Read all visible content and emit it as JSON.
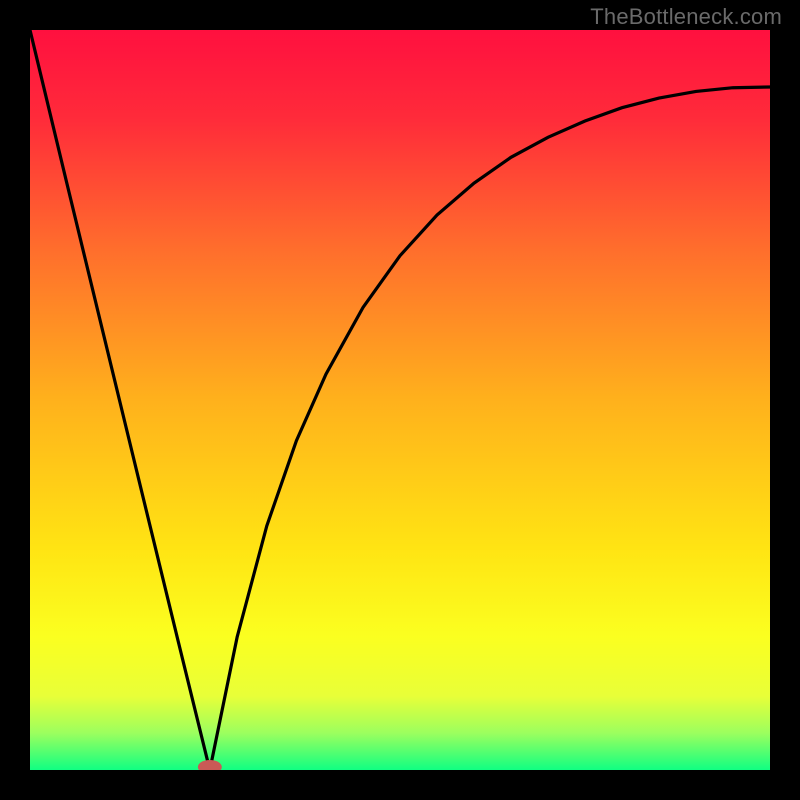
{
  "watermark": "TheBottleneck.com",
  "chart_data": {
    "type": "line",
    "x": [
      0.0,
      0.05,
      0.1,
      0.15,
      0.2,
      0.243,
      0.28,
      0.32,
      0.36,
      0.4,
      0.45,
      0.5,
      0.55,
      0.6,
      0.65,
      0.7,
      0.75,
      0.8,
      0.85,
      0.9,
      0.95,
      1.0
    ],
    "values": [
      1.0,
      0.792,
      0.586,
      0.38,
      0.175,
      0.0,
      0.18,
      0.33,
      0.445,
      0.535,
      0.625,
      0.695,
      0.75,
      0.793,
      0.828,
      0.855,
      0.877,
      0.895,
      0.908,
      0.917,
      0.922,
      0.923
    ],
    "series": [
      {
        "name": "curve",
        "values_ref": "see x/values"
      }
    ],
    "title": "",
    "xlabel": "",
    "ylabel": "",
    "xlim": [
      0,
      1
    ],
    "ylim": [
      0,
      1
    ],
    "background_gradient": {
      "stops": [
        {
          "offset": 0.0,
          "color": "#ff103f"
        },
        {
          "offset": 0.12,
          "color": "#ff2b3a"
        },
        {
          "offset": 0.3,
          "color": "#ff6f2c"
        },
        {
          "offset": 0.5,
          "color": "#ffb11c"
        },
        {
          "offset": 0.7,
          "color": "#ffe413"
        },
        {
          "offset": 0.82,
          "color": "#fbff20"
        },
        {
          "offset": 0.9,
          "color": "#e8ff38"
        },
        {
          "offset": 0.95,
          "color": "#9cff5e"
        },
        {
          "offset": 1.0,
          "color": "#10ff82"
        }
      ]
    },
    "marker": {
      "x": 0.243,
      "y": 0.0,
      "color": "#c95a56",
      "rx": 12,
      "ry": 7
    },
    "grid": false,
    "legend": false
  }
}
